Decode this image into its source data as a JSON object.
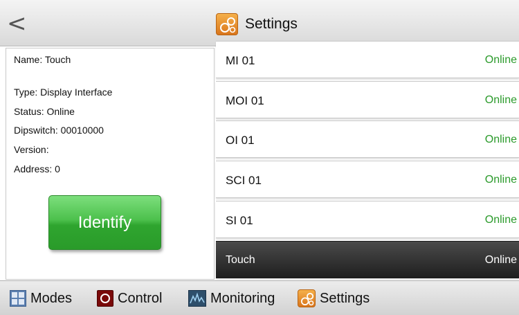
{
  "header": {
    "back_glyph": "<",
    "title": "Settings",
    "title_icon": "settings-gears-icon"
  },
  "device_info": {
    "name": "Name: Touch",
    "type": "Type: Display Interface",
    "status": "Status: Online",
    "dipswitch": "Dipswitch: 00010000",
    "version": "Version:",
    "address": "Address: 0",
    "identify_label": "Identify"
  },
  "devices": [
    {
      "name": "MI 01",
      "status": "Online"
    },
    {
      "name": "MOI 01",
      "status": "Online"
    },
    {
      "name": "OI 01",
      "status": "Online"
    },
    {
      "name": "SCI 01",
      "status": "Online"
    },
    {
      "name": "SI 01",
      "status": "Online"
    },
    {
      "name": "Touch",
      "status": "Online",
      "selected": true
    }
  ],
  "nav": [
    {
      "label": "Modes",
      "icon": "modes-icon"
    },
    {
      "label": "Control",
      "icon": "control-icon"
    },
    {
      "label": "Monitoring",
      "icon": "monitoring-icon"
    },
    {
      "label": "Settings",
      "icon": "settings-icon"
    }
  ],
  "colors": {
    "online": "#2a9a2a",
    "identify_green": "#3db23d",
    "settings_orange": "#e8912e",
    "selected_row": "#2b2b2b"
  }
}
